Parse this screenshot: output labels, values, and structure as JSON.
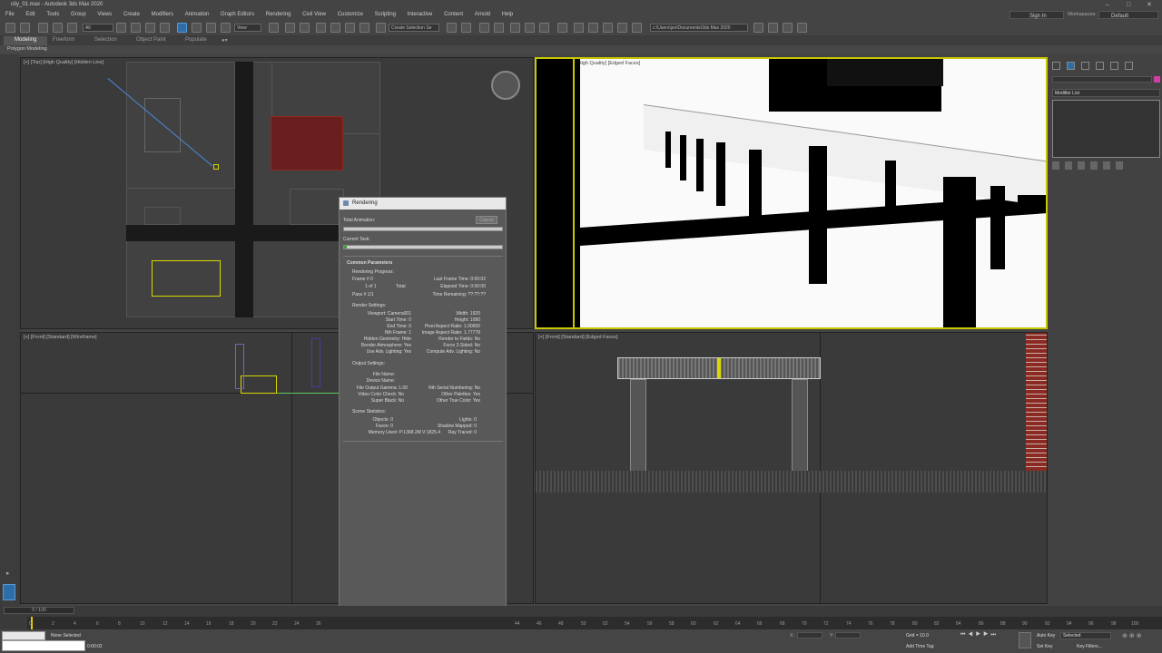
{
  "window": {
    "title": "city_01.max - Autodesk 3ds Max 2020"
  },
  "menu": [
    "File",
    "Edit",
    "Tools",
    "Group",
    "Views",
    "Create",
    "Modifiers",
    "Animation",
    "Graph Editors",
    "Rendering",
    "Civil View",
    "Customize",
    "Scripting",
    "Interactive",
    "Content",
    "Arnold",
    "Help"
  ],
  "account": {
    "signin": "Sign In",
    "workspaces_label": "Workspaces:",
    "workspace_value": "Default"
  },
  "toolbar": {
    "filter": "All",
    "view": "View",
    "selection_set": "Create Selection Se",
    "path": "c:\\Users\\jev\\Documents\\3ds Max 2020"
  },
  "ribbon": {
    "tabs": [
      "Modeling",
      "Freeform",
      "Selection",
      "Object Paint",
      "Populate"
    ],
    "sub": "Polygon Modeling"
  },
  "viewports": {
    "top": "[+] [Top] [High Quality] [Hidden Line]",
    "camera": "[+] [Camera001] [High Quality] [Edged Faces]",
    "left": "[+] [Front] [Standard] [Wireframe]",
    "front": "[+] [Front] [Standard] [Edged Faces]"
  },
  "rendering": {
    "title": "Rendering",
    "total_animation": "Total Animation:",
    "cancel": "Cancel",
    "current_task": "Current Task:",
    "common_params": "Common Parameters",
    "progress_label": "Rendering Progress:",
    "frame": "Frame #  0",
    "of": "1 of 1",
    "total": "Total",
    "pass": "Pass #  1/1",
    "last_frame_time": "Last Frame Time:  0:00:02",
    "elapsed_time": "Elapsed Time:  0:00:00",
    "time_remaining": "Time Remaining:  ??:??:??",
    "render_settings": "Render Settings:",
    "left_col": [
      "Viewport: Camera001",
      "Start Time: 0",
      "End Time: 0",
      "Nth Frame: 1",
      "Hidden Geometry: Hide",
      "Render Atmosphere: Yes",
      "Use Adv. Lighting: Yes"
    ],
    "right_col": [
      "Width: 1920",
      "Height: 1080",
      "Pixel Aspect Ratio: 1.00000",
      "Image Aspect Ratio: 1.77778",
      "Render to Fields: No",
      "Force 2-Sided: No",
      "Compute Adv. Lighting: No"
    ],
    "output_settings": "Output Settings:",
    "out_left": [
      "File Name:",
      "Device Name:",
      "File Output Gamma: 1.00",
      "Video Color Check: No",
      "Super Black: No"
    ],
    "out_right": [
      "Nth Serial Numbering: No",
      "Other Palettes: Yes",
      "Other True Color: Yes"
    ],
    "scene_stats": "Scene Statistics:",
    "stats_left": [
      "Objects: 0",
      "Faces: 0",
      "Memory Used: P:1368.2M V:1825.4"
    ],
    "stats_right": [
      "Lights: 0",
      "Shadow Mapped: 0",
      "Ray Traced: 0"
    ]
  },
  "command_panel": {
    "modifier_list": "Modifier List"
  },
  "timeline": {
    "frame_counter": "0 / 100",
    "ticks_left": [
      "0",
      "2",
      "4",
      "6",
      "8",
      "10",
      "12",
      "14",
      "16",
      "18",
      "20",
      "22",
      "24",
      "26"
    ],
    "ticks_right": [
      "44",
      "46",
      "48",
      "50",
      "52",
      "54",
      "56",
      "58",
      "60",
      "62",
      "64",
      "66",
      "68",
      "70",
      "72",
      "74",
      "76",
      "78",
      "80",
      "82",
      "84",
      "86",
      "88",
      "90",
      "92",
      "94",
      "96",
      "98",
      "100"
    ],
    "status": "None Selected",
    "time": "0:00:02",
    "grid": "Grid = 10.0",
    "add_time_tag": "Add Time Tag",
    "autokey": "Auto Key",
    "selected": "Selected",
    "setkey": "Set Key",
    "key_filters": "Key Filters...",
    "x_label": "X:",
    "y_label": "Y:"
  },
  "colors": {
    "accent": "#2e6ea8",
    "brick": "#8a2a22",
    "selection": "#d8d800",
    "timeline_blue": "#4a8ad8"
  }
}
